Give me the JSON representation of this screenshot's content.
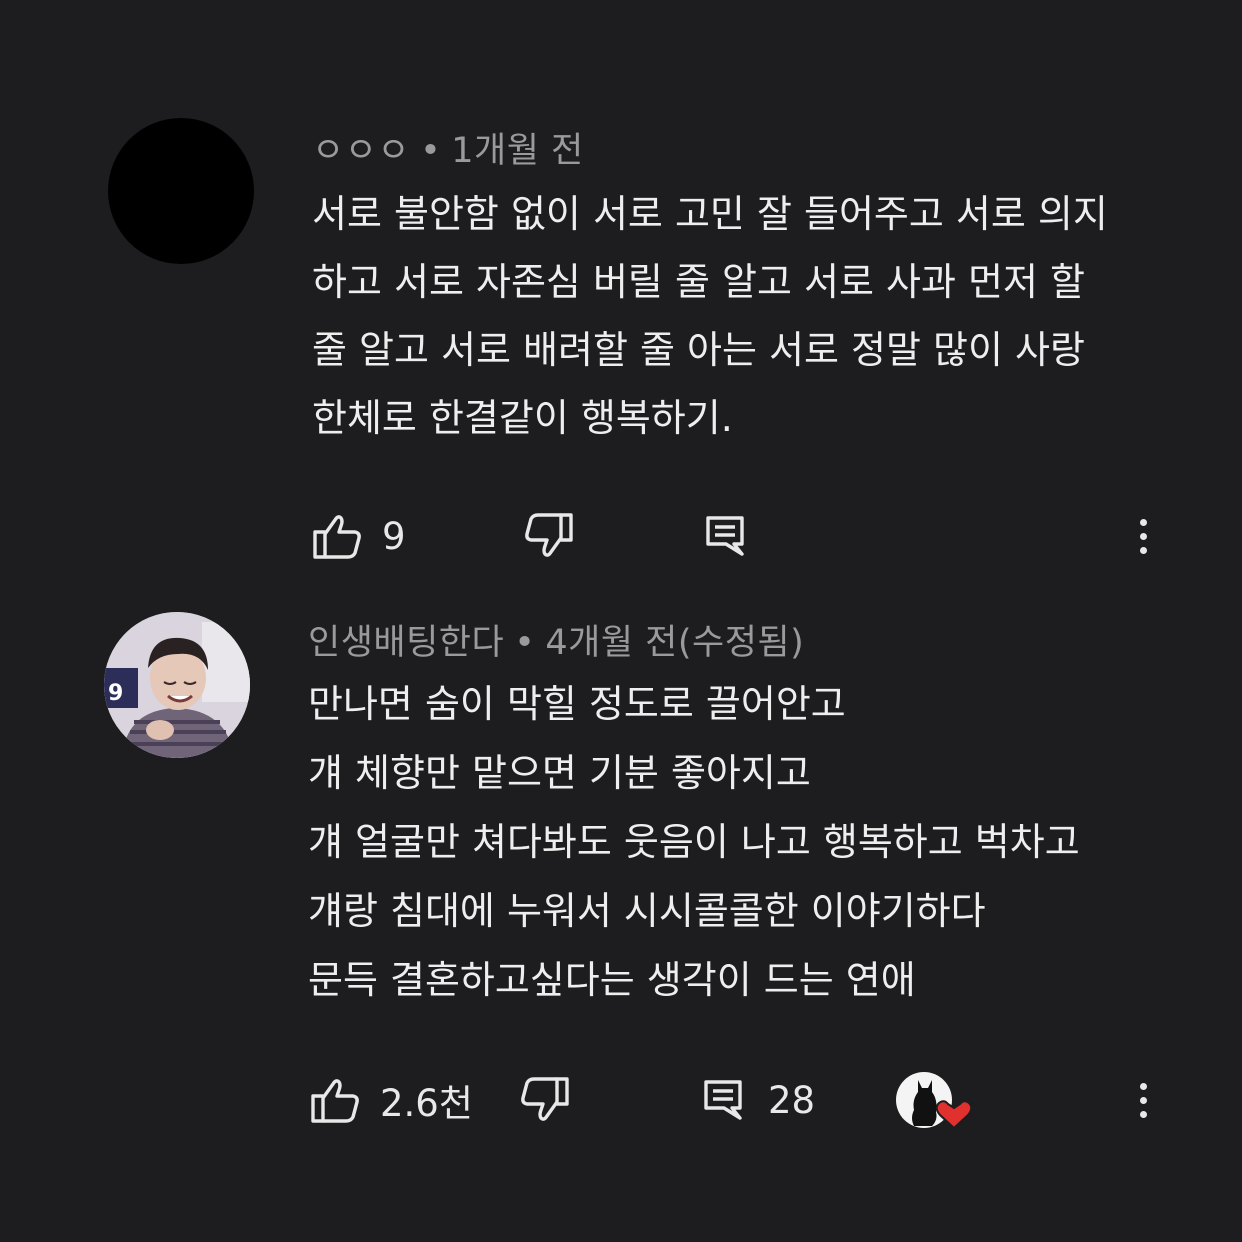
{
  "comments": [
    {
      "author": "ㅇㅇㅇ",
      "time": "1개월 전",
      "lines": [
        "서로 불안함 없이 서로 고민 잘 들어주고 서로 의지",
        "하고 서로 자존심 버릴 줄 알고 서로 사과 먼저 할",
        "줄 알고 서로 배려할 줄 아는 서로 정말 많이 사랑",
        "한체로 한결같이 행복하기."
      ],
      "likes": "9",
      "replies": ""
    },
    {
      "author": "인생배팅한다",
      "time": "4개월 전(수정됨)",
      "lines": [
        "만나면 숨이 막힐 정도로 끌어안고",
        "걔 체향만 맡으면 기분 좋아지고",
        "걔 얼굴만 쳐다봐도 웃음이 나고 행복하고 벅차고",
        "걔랑 침대에 누워서 시시콜콜한 이야기하다",
        "문득 결혼하고싶다는 생각이 드는 연애"
      ],
      "likes": "2.6천",
      "replies": "28"
    }
  ],
  "meta_separator": "•",
  "icons": {
    "like": "thumbs-up-icon",
    "dislike": "thumbs-down-icon",
    "reply": "reply-icon",
    "more": "more-vertical-icon",
    "creator_heart": "creator-heart-icon"
  },
  "colors": {
    "background": "#1d1d1f",
    "text": "#eeeeee",
    "meta": "#9a9a9a",
    "heart": "#e0312e"
  }
}
